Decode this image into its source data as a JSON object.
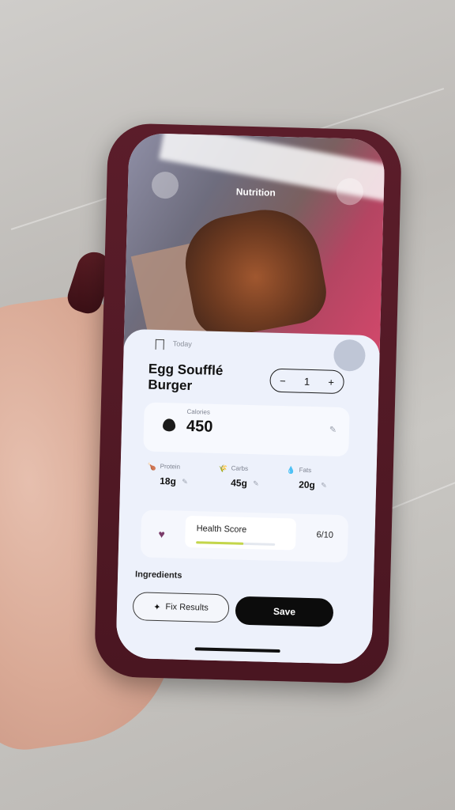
{
  "nav": {
    "title": "Nutrition"
  },
  "header": {
    "time_label": "Today"
  },
  "food": {
    "name": "Egg Soufflé Burger",
    "quantity": "1",
    "decrement": "−",
    "increment": "+"
  },
  "calories": {
    "label": "Calories",
    "value": "450"
  },
  "macros": [
    {
      "label": "Protein",
      "value": "18g"
    },
    {
      "label": "Carbs",
      "value": "45g"
    },
    {
      "label": "Fats",
      "value": "20g"
    }
  ],
  "health": {
    "label": "Health Score",
    "value": "6/10",
    "fraction": 0.6
  },
  "ingredients": {
    "label": "Ingredients"
  },
  "actions": {
    "fix_label": "Fix Results",
    "save_label": "Save"
  },
  "icons": {
    "bookmark": "bookmark-icon",
    "flame": "flame-icon",
    "heart": "heart-icon",
    "sparkle": "sparkle-icon",
    "edit": "pencil-icon"
  },
  "colors": {
    "accent": "#0c0c0c",
    "health_bar": "#c4d64a",
    "case": "#5b1d2a"
  }
}
